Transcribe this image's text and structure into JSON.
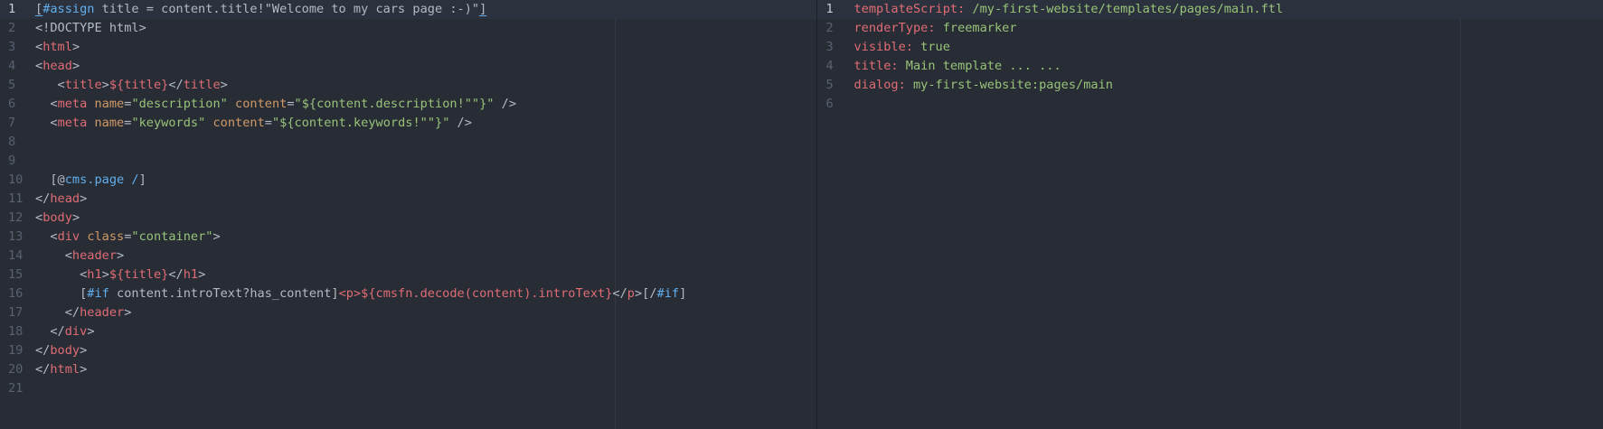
{
  "colors": {
    "background": "#272c35",
    "tag": "#e06c75",
    "attribute": "#d19a66",
    "string": "#98c379",
    "keyword": "#61afef",
    "plain": "#b4bac4",
    "line_number": "#5a6170"
  },
  "left_pane": {
    "file_type": "freemarker-template",
    "cursor_line": 1,
    "lines": [
      {
        "n": "1",
        "tokens": [
          [
            "b",
            "["
          ],
          [
            "k",
            "#assign"
          ],
          [
            "p",
            " title = content.title!\"Welcome to my cars page :-)\""
          ],
          [
            "b",
            "]"
          ]
        ]
      },
      {
        "n": "2",
        "tokens": [
          [
            "p",
            "<!DOCTYPE html>"
          ]
        ]
      },
      {
        "n": "3",
        "tokens": [
          [
            "p",
            "<"
          ],
          [
            "t",
            "html"
          ],
          [
            "p",
            ">"
          ]
        ]
      },
      {
        "n": "4",
        "tokens": [
          [
            "p",
            "<"
          ],
          [
            "t",
            "head"
          ],
          [
            "p",
            ">"
          ]
        ]
      },
      {
        "n": "5",
        "tokens": [
          [
            "p",
            "   <"
          ],
          [
            "t",
            "title"
          ],
          [
            "p",
            ">"
          ],
          [
            "t",
            "${title}"
          ],
          [
            "p",
            "</"
          ],
          [
            "t",
            "title"
          ],
          [
            "p",
            ">"
          ]
        ]
      },
      {
        "n": "6",
        "tokens": [
          [
            "p",
            "  <"
          ],
          [
            "t",
            "meta"
          ],
          [
            "p",
            " "
          ],
          [
            "a",
            "name"
          ],
          [
            "p",
            "="
          ],
          [
            "s",
            "\"description\""
          ],
          [
            "p",
            " "
          ],
          [
            "a",
            "content"
          ],
          [
            "p",
            "="
          ],
          [
            "s",
            "\"${content.description!\"\"}\""
          ],
          [
            "p",
            " />"
          ]
        ]
      },
      {
        "n": "7",
        "tokens": [
          [
            "p",
            "  <"
          ],
          [
            "t",
            "meta"
          ],
          [
            "p",
            " "
          ],
          [
            "a",
            "name"
          ],
          [
            "p",
            "="
          ],
          [
            "s",
            "\"keywords\""
          ],
          [
            "p",
            " "
          ],
          [
            "a",
            "content"
          ],
          [
            "p",
            "="
          ],
          [
            "s",
            "\"${content.keywords!\"\"}\""
          ],
          [
            "p",
            " />"
          ]
        ]
      },
      {
        "n": "8",
        "tokens": []
      },
      {
        "n": "9",
        "tokens": []
      },
      {
        "n": "10",
        "tokens": [
          [
            "p",
            "  [@"
          ],
          [
            "k",
            "cms.page"
          ],
          [
            "p",
            " "
          ],
          [
            "k",
            "/"
          ],
          [
            "p",
            "]"
          ]
        ]
      },
      {
        "n": "11",
        "tokens": [
          [
            "p",
            "</"
          ],
          [
            "t",
            "head"
          ],
          [
            "p",
            ">"
          ]
        ]
      },
      {
        "n": "12",
        "tokens": [
          [
            "p",
            "<"
          ],
          [
            "t",
            "body"
          ],
          [
            "p",
            ">"
          ]
        ]
      },
      {
        "n": "13",
        "tokens": [
          [
            "p",
            "  <"
          ],
          [
            "t",
            "div"
          ],
          [
            "p",
            " "
          ],
          [
            "a",
            "class"
          ],
          [
            "p",
            "="
          ],
          [
            "s",
            "\"container\""
          ],
          [
            "p",
            ">"
          ]
        ]
      },
      {
        "n": "14",
        "tokens": [
          [
            "p",
            "    <"
          ],
          [
            "t",
            "header"
          ],
          [
            "p",
            ">"
          ]
        ]
      },
      {
        "n": "15",
        "tokens": [
          [
            "p",
            "      <"
          ],
          [
            "t",
            "h1"
          ],
          [
            "p",
            ">"
          ],
          [
            "t",
            "${title}"
          ],
          [
            "p",
            "</"
          ],
          [
            "t",
            "h1"
          ],
          [
            "p",
            ">"
          ]
        ]
      },
      {
        "n": "16",
        "tokens": [
          [
            "p",
            "      ["
          ],
          [
            "k",
            "#if"
          ],
          [
            "p",
            " content.introText?has_content]"
          ],
          [
            "t",
            "<p>"
          ],
          [
            "t",
            "${cmsfn.decode(content).introText}"
          ],
          [
            "p",
            "</"
          ],
          [
            "t",
            "p"
          ],
          [
            "p",
            ">[/"
          ],
          [
            "k",
            "#if"
          ],
          [
            "p",
            "]"
          ]
        ]
      },
      {
        "n": "17",
        "tokens": [
          [
            "p",
            "    </"
          ],
          [
            "t",
            "header"
          ],
          [
            "p",
            ">"
          ]
        ]
      },
      {
        "n": "18",
        "tokens": [
          [
            "p",
            "  </"
          ],
          [
            "t",
            "div"
          ],
          [
            "p",
            ">"
          ]
        ]
      },
      {
        "n": "19",
        "tokens": [
          [
            "p",
            "</"
          ],
          [
            "t",
            "body"
          ],
          [
            "p",
            ">"
          ]
        ]
      },
      {
        "n": "20",
        "tokens": [
          [
            "p",
            "</"
          ],
          [
            "t",
            "html"
          ],
          [
            "p",
            ">"
          ]
        ]
      },
      {
        "n": "21",
        "tokens": []
      }
    ]
  },
  "right_pane": {
    "file_type": "yaml",
    "cursor_line": 1,
    "lines": [
      {
        "n": "1",
        "tokens": [
          [
            "y",
            "templateScript:"
          ],
          [
            "v",
            " /my-first-website/templates/pages/main.ftl"
          ]
        ]
      },
      {
        "n": "2",
        "tokens": [
          [
            "y",
            "renderType:"
          ],
          [
            "v",
            " freemarker"
          ]
        ]
      },
      {
        "n": "3",
        "tokens": [
          [
            "y",
            "visible:"
          ],
          [
            "v",
            " true"
          ]
        ]
      },
      {
        "n": "4",
        "tokens": [
          [
            "y",
            "title:"
          ],
          [
            "v",
            " Main template ... ..."
          ]
        ]
      },
      {
        "n": "5",
        "tokens": [
          [
            "y",
            "dialog:"
          ],
          [
            "v",
            " my-first-website:pages/main"
          ]
        ]
      },
      {
        "n": "6",
        "tokens": []
      }
    ]
  }
}
